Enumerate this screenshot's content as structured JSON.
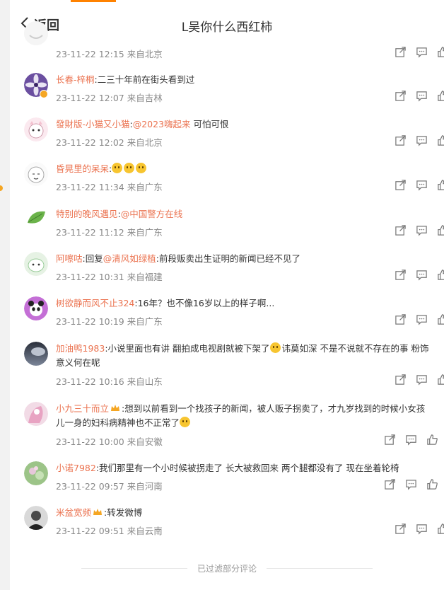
{
  "header": {
    "back_label": "返回",
    "title": "L吴你什么西红柿"
  },
  "comments": [
    {
      "nick": "",
      "text": "",
      "meta": "23-11-22 12:15 来自北京"
    },
    {
      "nick": "长春-梓桐",
      "text": ":二三十年前在街头看到过",
      "meta": "23-11-22 12:07 来自吉林"
    },
    {
      "nick": "發財版-小猫又小猫",
      "text_pre": ":",
      "at": "@2023嗨起来",
      "text": " 可怕可恨",
      "meta": "23-11-22 12:02 来自北京"
    },
    {
      "nick": "昏晃里的呆呆",
      "text": ":",
      "meta": "23-11-22 11:34 来自广东"
    },
    {
      "nick": "特别的晚风遇见",
      "text_pre": ":",
      "at": "@中国警方在线",
      "text": "",
      "meta": "23-11-22 11:12 来自广东"
    },
    {
      "nick": "阿嚓咕",
      "text_pre": ":回复",
      "at": "@清风如绿植",
      "text": ":前段贩卖出生证明的新闻已经不见了",
      "meta": "23-11-22 10:31 来自福建"
    },
    {
      "nick": "树欲静而风不止324",
      "text": ":16年？也不像16岁以上的样子啊...",
      "meta": "23-11-22 10:19 来自广东"
    },
    {
      "nick": "加油鸭1983",
      "text": ":小说里面也有讲 翻拍成电视剧就被下架了",
      "text2": "讳莫如深 不是不说就不存在的事 粉饰",
      "text3": "意义何在呢",
      "meta": "23-11-22 10:16 来自山东"
    },
    {
      "nick": "小九三十而立",
      "text": ":想到以前看到一个找孩子的新闻，被人贩子拐卖了，才九岁找到的时候小女孩",
      "text3": "儿一身的妇科病精神也不正常了",
      "meta": "23-11-22 10:00 来自安徽"
    },
    {
      "nick": "小诺7982",
      "text": ":我们那里有一个小时候被拐走了 长大被救回来 两个腿都没有了 现在坐着轮椅",
      "meta": "23-11-22 09:57 来自河南"
    },
    {
      "nick": "米盆宽频",
      "text": ":转发微博",
      "meta": "23-11-22 09:51 来自云南"
    }
  ],
  "footer": {
    "filtered_label": "已过滤部分评论"
  },
  "icons": {
    "share": "share-icon",
    "comment": "comment-icon",
    "like": "like-icon",
    "back": "chevron-left-icon"
  },
  "colors": {
    "accent": "#ff8200",
    "nick": "#eb7350",
    "meta": "#888888"
  }
}
